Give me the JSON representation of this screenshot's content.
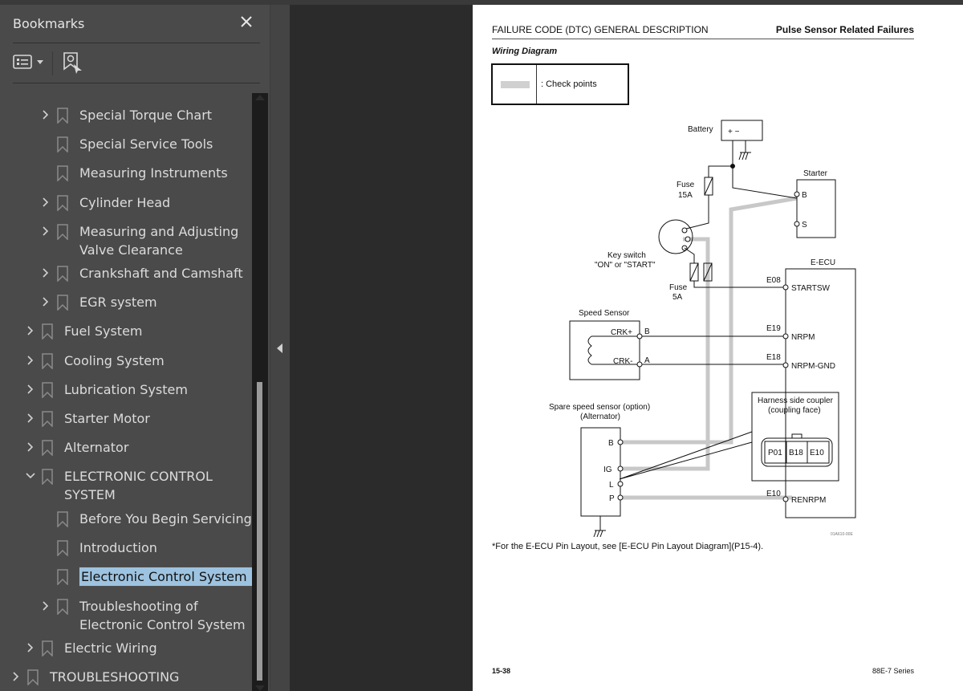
{
  "bookmarks_panel": {
    "title": "Bookmarks",
    "close_icon": "close-icon",
    "toolbar": {
      "options_icon": "list-options-icon",
      "dropdown_icon": "caret-down-icon",
      "find_bookmark_icon": "find-current-bookmark-icon"
    },
    "items": [
      {
        "label": "Special Torque Chart",
        "level": 2,
        "expandable": true
      },
      {
        "label": "Special Service Tools",
        "level": 2,
        "expandable": false
      },
      {
        "label": "Measuring Instruments",
        "level": 2,
        "expandable": false
      },
      {
        "label": "Cylinder Head",
        "level": 2,
        "expandable": true
      },
      {
        "label": "Measuring and Adjusting",
        "label2": "Valve Clearance",
        "level": 2,
        "expandable": true
      },
      {
        "label": "Crankshaft and Camshaft",
        "level": 2,
        "expandable": true
      },
      {
        "label": "EGR system",
        "level": 2,
        "expandable": true
      },
      {
        "label": "Fuel System",
        "level": 1,
        "expandable": true
      },
      {
        "label": "Cooling System",
        "level": 1,
        "expandable": true
      },
      {
        "label": "Lubrication System",
        "level": 1,
        "expandable": true
      },
      {
        "label": "Starter Motor",
        "level": 1,
        "expandable": true
      },
      {
        "label": "Alternator",
        "level": 1,
        "expandable": true
      },
      {
        "label": "ELECTRONIC CONTROL",
        "label2": "SYSTEM",
        "level": 1,
        "expandable": true,
        "expanded": true
      },
      {
        "label": "Before You Begin Servicing",
        "level": 2,
        "expandable": false
      },
      {
        "label": "Introduction",
        "level": 2,
        "expandable": false
      },
      {
        "label": "Electronic Control System",
        "level": 2,
        "expandable": false,
        "selected": true
      },
      {
        "label": "Troubleshooting of",
        "label2": "Electronic Control System",
        "level": 2,
        "expandable": true
      },
      {
        "label": "Electric Wiring",
        "level": 1,
        "expandable": true
      },
      {
        "label": "TROUBLESHOOTING",
        "level": 0,
        "expandable": true
      }
    ],
    "selected_color": "#9dc3e0"
  },
  "splitter": {
    "collapse_icon": "collapse-left-icon"
  },
  "page": {
    "header_left": "FAILURE CODE (DTC) GENERAL DESCRIPTION",
    "header_right": "Pulse Sensor Related Failures",
    "subtitle": "Wiring Diagram",
    "legend_text": ": Check points",
    "diagram": {
      "battery": "Battery",
      "battery_terms": "+  −",
      "fuse1": "Fuse",
      "fuse1_rating": "15A",
      "starter": "Starter",
      "starter_b": "B",
      "starter_s": "S",
      "key_switch": "Key switch",
      "key_switch_pos": "\"ON\" or  \"START\"",
      "fuse2": "Fuse",
      "fuse2_rating": "5A",
      "ecu": "E-ECU",
      "e08": "E08",
      "startsw": "STARTSW",
      "speed_sensor": "Speed Sensor",
      "crk_plus": "CRK+",
      "crk_minus": "CRK-",
      "pin_b": "B",
      "pin_a": "A",
      "e19": "E19",
      "nrpm": "NRPM",
      "e18": "E18",
      "nrpm_gnd": "NRPM-GND",
      "spare_sensor": "Spare speed sensor (option)",
      "alternator": "(Alternator)",
      "alt_b": "B",
      "alt_ig": "IG",
      "alt_l": "L",
      "alt_p": "P",
      "harness": "Harness side coupler",
      "coupling_face": "(coupling face)",
      "pins": [
        "P01",
        "B18",
        "E10"
      ],
      "e10": "E10",
      "renrpm": "RENRPM",
      "fig_id": "01A610-00E"
    },
    "note": "*For the E-ECU Pin Layout, see [E-ECU Pin Layout Diagram](P15-4).",
    "footer_left": "15-38",
    "footer_right": "88E-7 Series"
  }
}
